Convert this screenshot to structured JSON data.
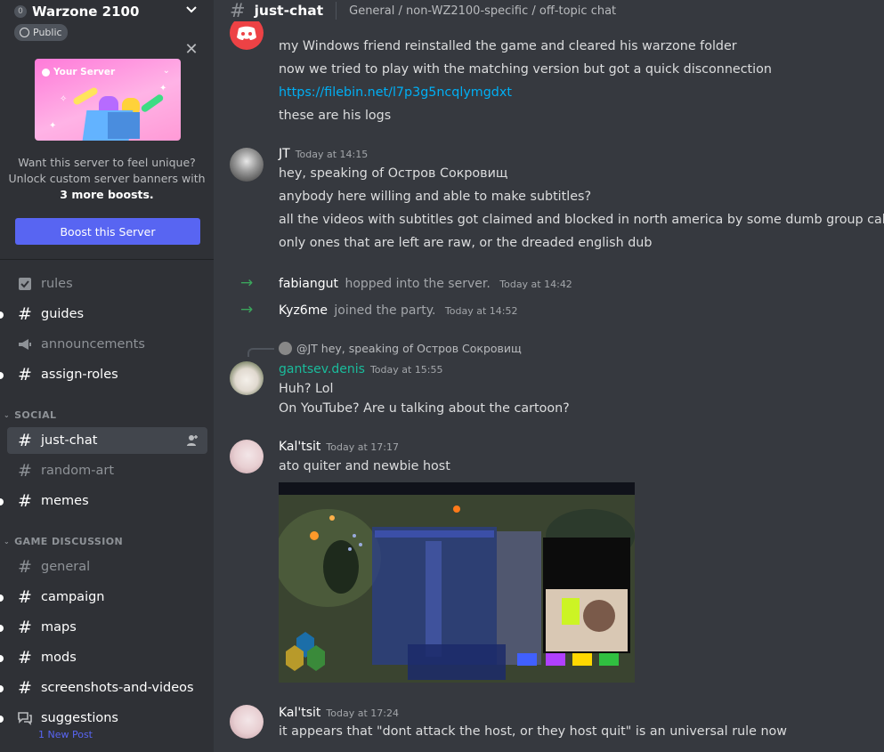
{
  "sidebar": {
    "server_icon_glyph": "0",
    "server_name": "Warzone 2100",
    "public_label": "Public",
    "boost_card_title": "Your Server",
    "boost_text_line1": "Want this server to feel unique?",
    "boost_text_line2": "Unlock custom server banners with",
    "boost_text_bold": "3 more boosts.",
    "boost_button": "Boost this Server",
    "channels": {
      "rules": "rules",
      "guides": "guides",
      "announcements": "announcements",
      "assign_roles": "assign-roles",
      "just_chat": "just-chat",
      "random_art": "random-art",
      "memes": "memes",
      "general": "general",
      "campaign": "campaign",
      "maps": "maps",
      "mods": "mods",
      "screenshots": "screenshots-and-videos",
      "suggestions": "suggestions",
      "suggestions_sub": "1 New Post"
    },
    "categories": {
      "social": "SOCIAL",
      "game_discussion": "GAME DISCUSSION"
    },
    "hash_glyph": "#"
  },
  "header": {
    "channel_name": "just-chat",
    "topic": "General / non-WZ2100-specific / off-topic chat"
  },
  "messages": {
    "m1": {
      "lines": [
        "my Windows friend reinstalled the game and cleared his warzone folder",
        "now we tried to play with the matching version but got a quick disconnection"
      ],
      "link": "https://filebin.net/l7p3g5ncqlymgdxt",
      "line_after_link": "these are his logs"
    },
    "m2": {
      "author": "JT",
      "time": "Today at 14:15",
      "lines": [
        "hey, speaking of Остров Сокровищ",
        "anybody here willing and able to make subtitles?",
        "all the videos with subtitles got claimed and blocked in north america by some dumb group called Lasso",
        "only ones that are left are raw, or the dreaded english dub"
      ]
    },
    "join1": {
      "name": "fabiangut",
      "text": "hopped into the server.",
      "time": "Today at 14:42"
    },
    "join2": {
      "name": "Kyz6me",
      "text": "joined the party.",
      "time": "Today at 14:52"
    },
    "m3": {
      "reply_text": "@JT hey, speaking of Остров Сокровищ",
      "author": "gantsev.denis",
      "author_color": "#1abc9c",
      "time": "Today at 15:55",
      "lines": [
        "Huh? Lol",
        "On YouTube? Are u talking about the cartoon?"
      ]
    },
    "m4": {
      "author": "Kal'tsit",
      "time": "Today at 17:17",
      "lines": [
        "ato quiter and newbie host"
      ]
    },
    "m5": {
      "author": "Kal'tsit",
      "time": "Today at 17:24",
      "lines": [
        "it appears that \"dont attack the host, or they host quit\" is an universal rule now"
      ]
    }
  },
  "colors": {
    "blurple": "#5865f2",
    "link": "#00aff4",
    "join_green": "#3ba55c",
    "discord_red": "#ed4245"
  }
}
